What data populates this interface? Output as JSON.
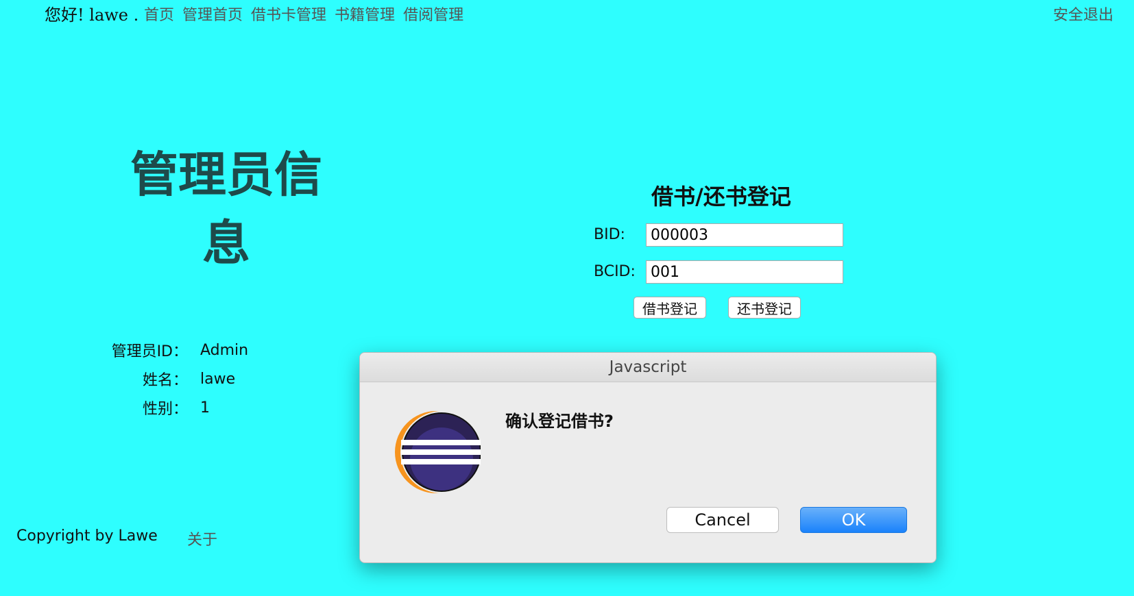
{
  "header": {
    "greeting": "您好! lawe .",
    "nav": [
      "首页",
      "管理首页",
      "借书卡管理",
      "书籍管理",
      "借阅管理"
    ],
    "logout": "安全退出"
  },
  "admin": {
    "title": "管理员信息",
    "fields": [
      {
        "label": "管理员ID：",
        "value": "Admin"
      },
      {
        "label": "姓名：",
        "value": "lawe"
      },
      {
        "label": "性别：",
        "value": "1"
      }
    ]
  },
  "borrow_form": {
    "title": "借书/还书登记",
    "bid_label": "BID:",
    "bid_value": "000003",
    "bcid_label": "BCID:",
    "bcid_value": "001",
    "borrow_button": "借书登记",
    "return_button": "还书登记"
  },
  "footer": {
    "copyright": "Copyright by Lawe",
    "about": "关于"
  },
  "dialog": {
    "title": "Javascript",
    "message": "确认登记借书?",
    "icon": "eclipse-icon",
    "cancel": "Cancel",
    "ok": "OK"
  },
  "colors": {
    "background": "#2efefe",
    "ok_button": "#1a82fb",
    "eclipse_purple": "#2c2255",
    "eclipse_orange": "#f7941e"
  }
}
